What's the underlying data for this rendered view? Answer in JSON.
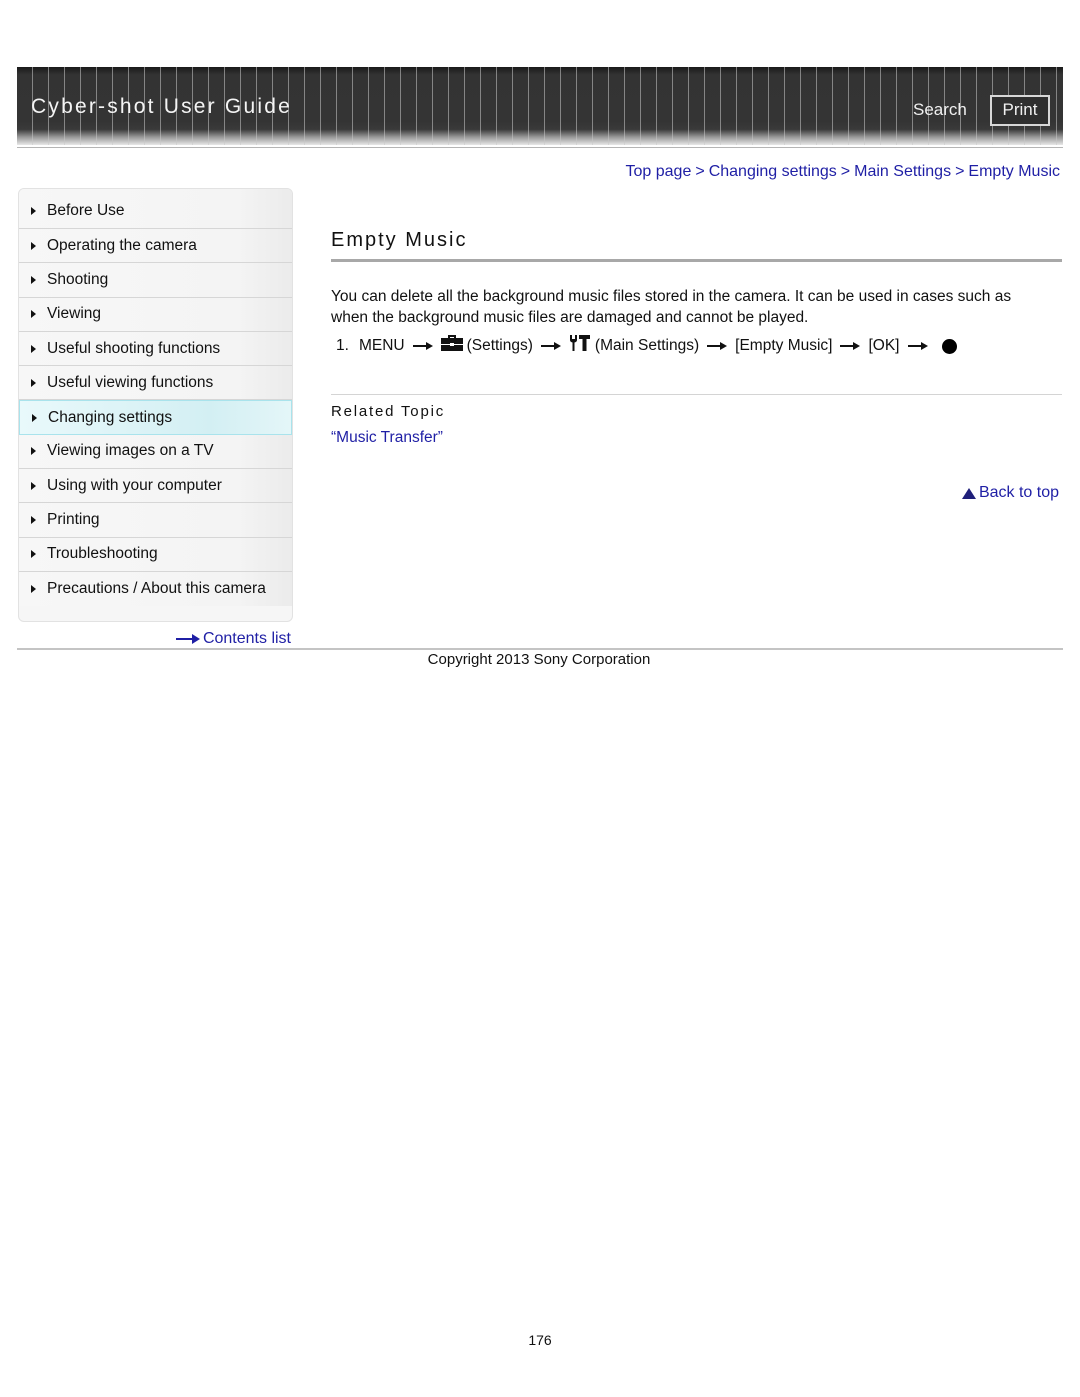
{
  "header": {
    "title": "Cyber-shot User Guide",
    "search_label": "Search",
    "print_label": "Print"
  },
  "breadcrumb": {
    "items": [
      "Top page",
      "Changing settings",
      "Main Settings",
      "Empty Music"
    ],
    "separator": ">"
  },
  "sidebar": {
    "items": [
      {
        "label": "Before Use",
        "active": false
      },
      {
        "label": "Operating the camera",
        "active": false
      },
      {
        "label": "Shooting",
        "active": false
      },
      {
        "label": "Viewing",
        "active": false
      },
      {
        "label": "Useful shooting functions",
        "active": false
      },
      {
        "label": "Useful viewing functions",
        "active": false
      },
      {
        "label": "Changing settings",
        "active": true
      },
      {
        "label": "Viewing images on a TV",
        "active": false
      },
      {
        "label": "Using with your computer",
        "active": false
      },
      {
        "label": "Printing",
        "active": false
      },
      {
        "label": "Troubleshooting",
        "active": false
      },
      {
        "label": "Precautions / About this camera",
        "active": false
      }
    ],
    "contents_link": "Contents list"
  },
  "main": {
    "title": "Empty Music",
    "description": "You can delete all the background music files stored in the camera. It can be used in cases such as when the background music files are damaged and cannot be played.",
    "step": {
      "number": "1.",
      "menu": "MENU",
      "settings_icon": "toolbox-icon",
      "settings": "(Settings)",
      "main_settings_icon": "wrench-hammer-icon",
      "main_settings": "(Main Settings)",
      "empty_music": "[Empty Music]",
      "ok": "[OK]",
      "final_icon": "center-button-dot-icon"
    },
    "related_heading": "Related Topic",
    "related_link": "“Music Transfer”",
    "back_to_top": "Back to top"
  },
  "footer": {
    "copyright": "Copyright 2013 Sony Corporation",
    "page_number": "176"
  },
  "colors": {
    "link": "#1f1fa5",
    "header_bg": "#333333",
    "active_nav": "#d3eff3"
  }
}
